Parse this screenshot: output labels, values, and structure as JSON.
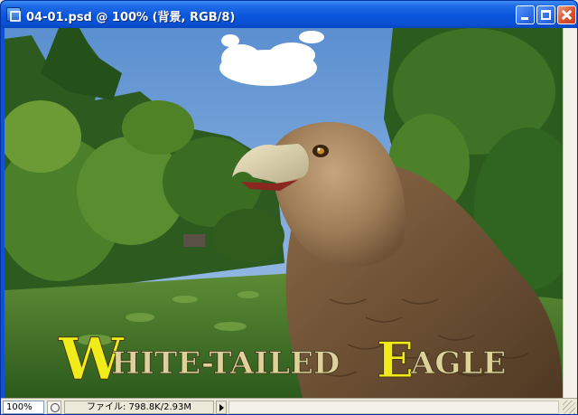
{
  "window": {
    "title": "04-01.psd @ 100% (背景, RGB/8)",
    "controls": {
      "minimize": "minimize",
      "maximize": "maximize",
      "close": "close"
    }
  },
  "canvas": {
    "caption_initial_1": "W",
    "caption_word_1": "HITE-TAILED",
    "caption_initial_2": "E",
    "caption_word_2": "AGLE",
    "caption_initial_color": "#f0ec1a",
    "caption_text_color": "#ddd29a",
    "sky_color": "#6d9fd6",
    "foliage_color": "#2f6a24"
  },
  "statusbar": {
    "zoom": "100%",
    "info": "ファイル: 798.8K/2.93M"
  }
}
